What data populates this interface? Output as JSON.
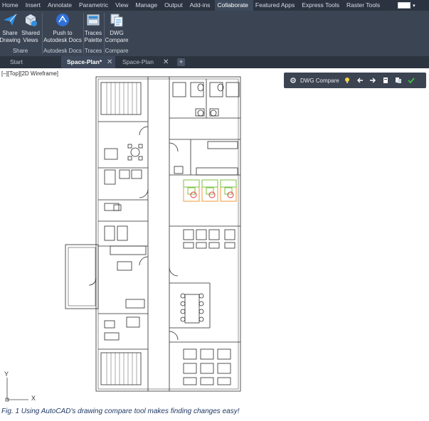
{
  "ribbon": {
    "tabs": [
      "Home",
      "Insert",
      "Annotate",
      "Parametric",
      "View",
      "Manage",
      "Output",
      "Add-ins",
      "Collaborate",
      "Featured Apps",
      "Express Tools",
      "Raster Tools"
    ],
    "active_tab": "Collaborate",
    "buttons": {
      "share_drawing": [
        "Share",
        "Drawing"
      ],
      "shared_views": [
        "Shared",
        "Views"
      ],
      "push_to_docs": [
        "Push to",
        "Autodesk Docs"
      ],
      "traces_palette": [
        "Traces",
        "Palette"
      ],
      "dwg_compare": [
        "DWG",
        "Compare"
      ]
    },
    "groups": {
      "share": "Share",
      "autodesk_docs": "Autodesk Docs",
      "traces": "Traces",
      "compare": "Compare"
    }
  },
  "doc_tabs": {
    "start": "Start",
    "active": "Space-Plan*",
    "other": "Space-Plan",
    "close": "✕",
    "add": "+"
  },
  "viewport": {
    "label": "[–][Top][2D Wireframe]",
    "compare_toolbar_title": "DWG Compare",
    "ucs_x": "X",
    "ucs_y": "Y"
  },
  "colors": {
    "accent_blue": "#2f8ee0",
    "highlight_green": "#7cc142",
    "highlight_red": "#e8323a",
    "highlight_orange": "#f29a3a",
    "check_green": "#3fc23f",
    "bulb_yellow": "#f5d442"
  },
  "icons": {
    "share_drawing": "paper-plane-icon",
    "shared_views": "shared-views-icon",
    "push_to_docs": "autodesk-docs-icon",
    "traces_palette": "traces-palette-icon",
    "dwg_compare": "dwg-compare-icon",
    "settings": "gear-icon",
    "bulb": "lightbulb-icon",
    "prev": "arrow-left-icon",
    "next": "arrow-right-icon",
    "snapshot": "snapshot-icon",
    "import": "import-icon",
    "done": "checkmark-icon"
  },
  "caption": "Fig. 1 Using AutoCAD's drawing compare tool makes finding changes easy!"
}
